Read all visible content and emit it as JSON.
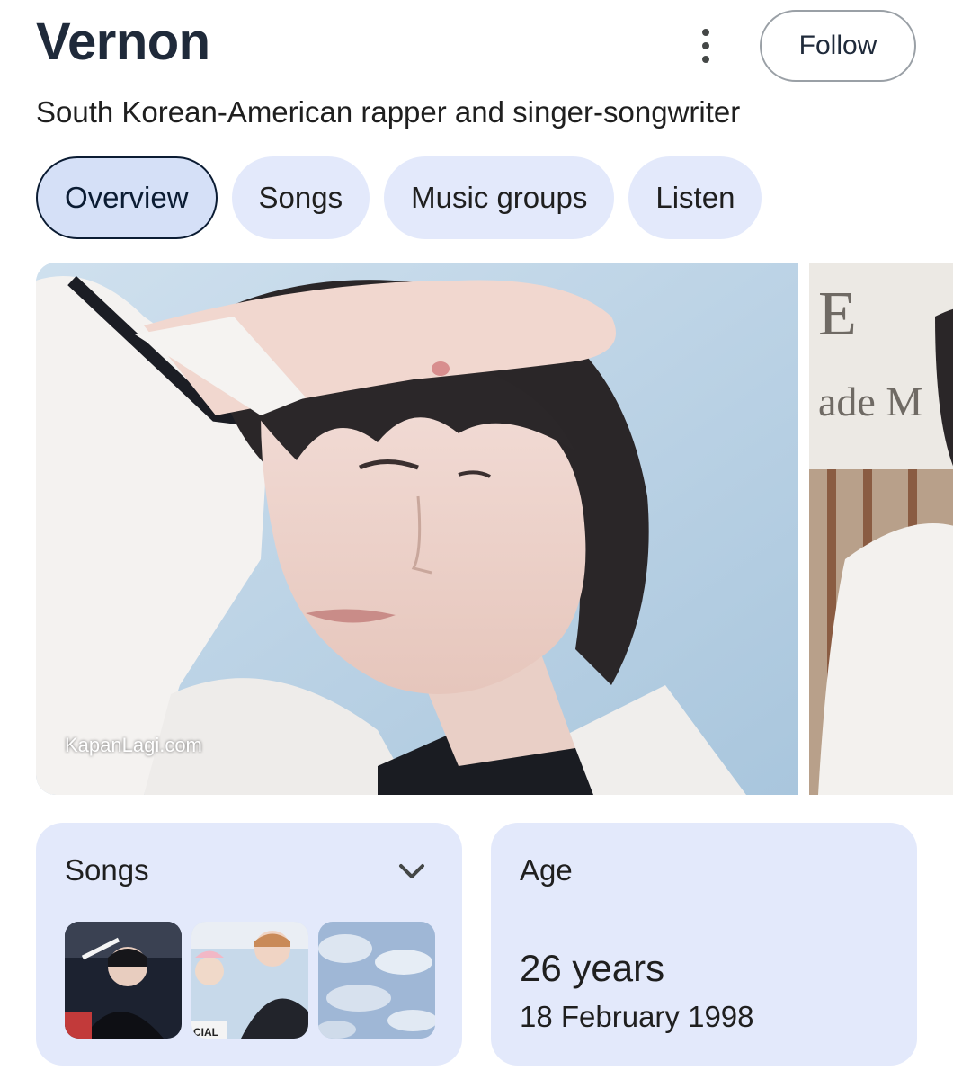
{
  "header": {
    "title": "Vernon",
    "subtitle": "South Korean-American rapper and singer-songwriter",
    "follow_label": "Follow",
    "more_icon": "more-vert-icon"
  },
  "tabs": [
    {
      "label": "Overview",
      "active": true
    },
    {
      "label": "Songs",
      "active": false
    },
    {
      "label": "Music groups",
      "active": false
    },
    {
      "label": "Listen",
      "active": false
    }
  ],
  "gallery": {
    "watermark": "KapanLagi.com",
    "second_text": "ade M"
  },
  "cards": {
    "songs": {
      "title": "Songs",
      "chevron_icon": "chevron-down-icon",
      "thumb3_text": "CIAL"
    },
    "age": {
      "title": "Age",
      "value": "26 years",
      "date": "18 February 1998"
    }
  },
  "colors": {
    "chip_bg": "#e3e9fb",
    "chip_active_bg": "#d5e0f7",
    "chip_active_border": "#0b1c33",
    "title_text": "#1f2a3a"
  }
}
